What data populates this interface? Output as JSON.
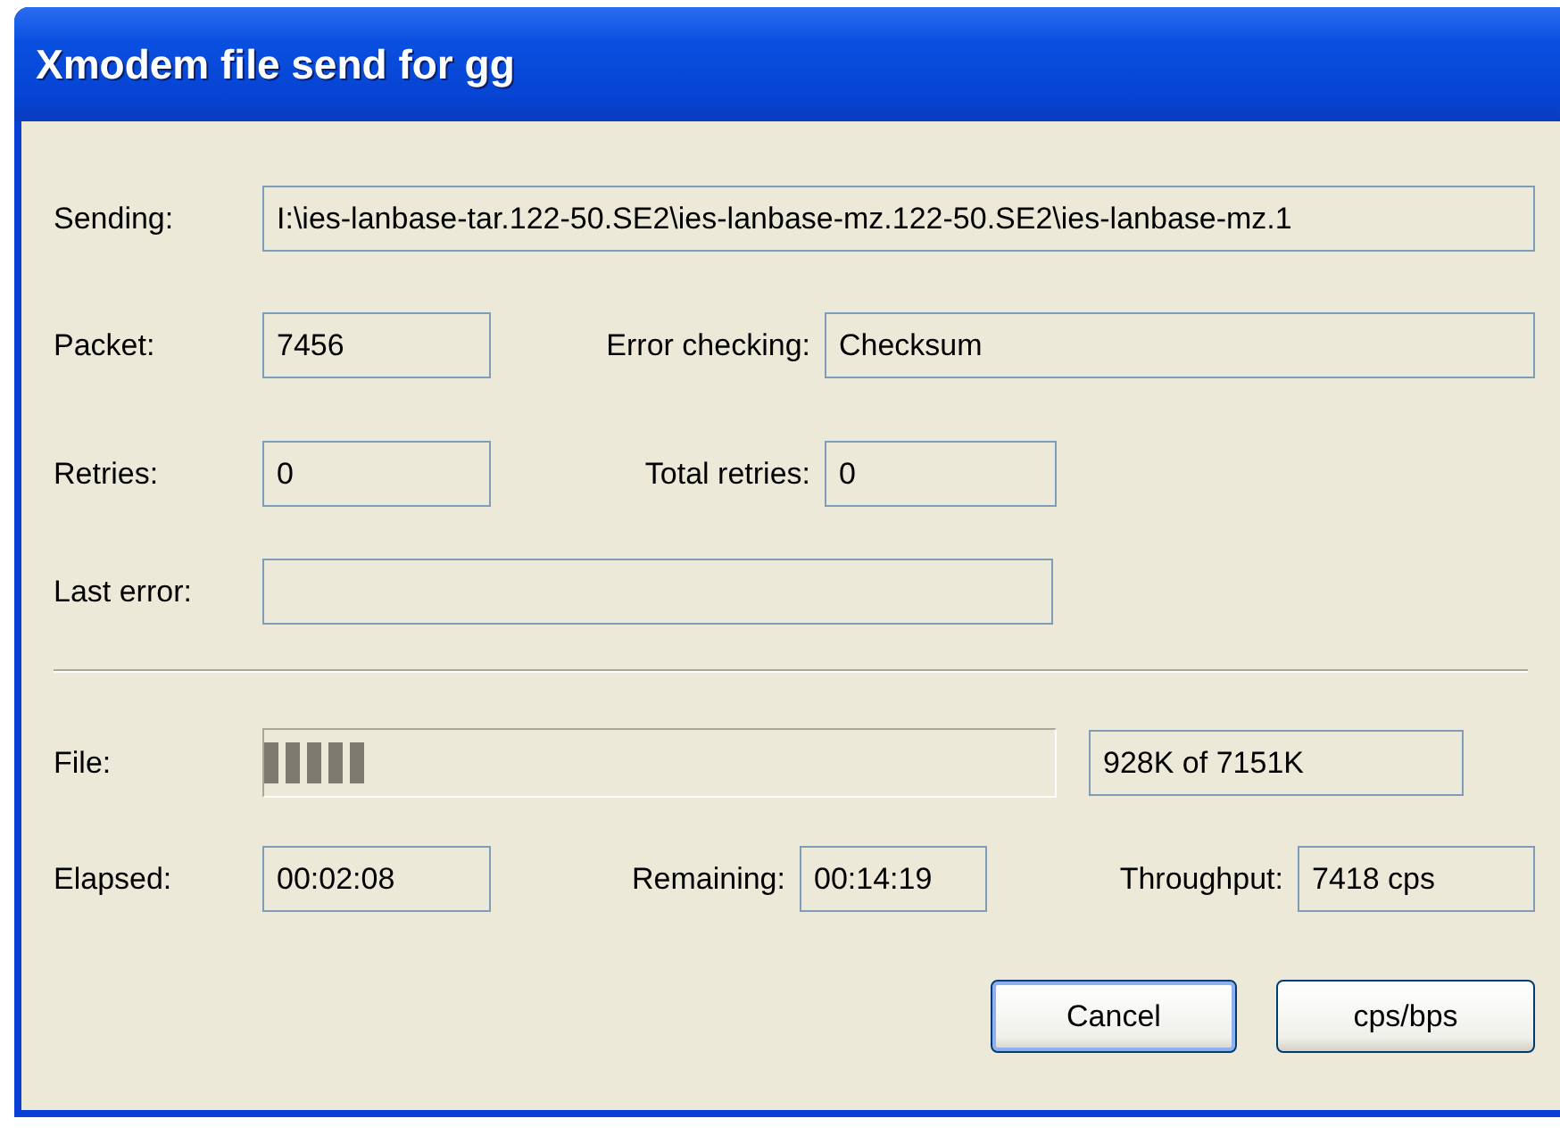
{
  "window": {
    "title": "Xmodem file send for gg"
  },
  "sending": {
    "label": "Sending:",
    "value": "I:\\ies-lanbase-tar.122-50.SE2\\ies-lanbase-mz.122-50.SE2\\ies-lanbase-mz.1"
  },
  "packet": {
    "label": "Packet:",
    "value": "7456"
  },
  "error_checking": {
    "label": "Error checking:",
    "value": "Checksum"
  },
  "retries": {
    "label": "Retries:",
    "value": "0"
  },
  "total_retries": {
    "label": "Total retries:",
    "value": "0"
  },
  "last_error": {
    "label": "Last error:"
  },
  "file": {
    "label": "File:",
    "level": 0.13,
    "reading": "928K of 7151K"
  },
  "elapsed": {
    "label": "Elapsed:",
    "value": "00:02:08"
  },
  "remaining": {
    "label": "Remaining:",
    "value": "00:14:19"
  },
  "throughput": {
    "label": "Throughput:",
    "value": "7418 cps"
  },
  "buttons": [
    {
      "label": "Cancel",
      "kind": "default"
    },
    {
      "label": "cps/bps",
      "kind": "normal"
    }
  ]
}
